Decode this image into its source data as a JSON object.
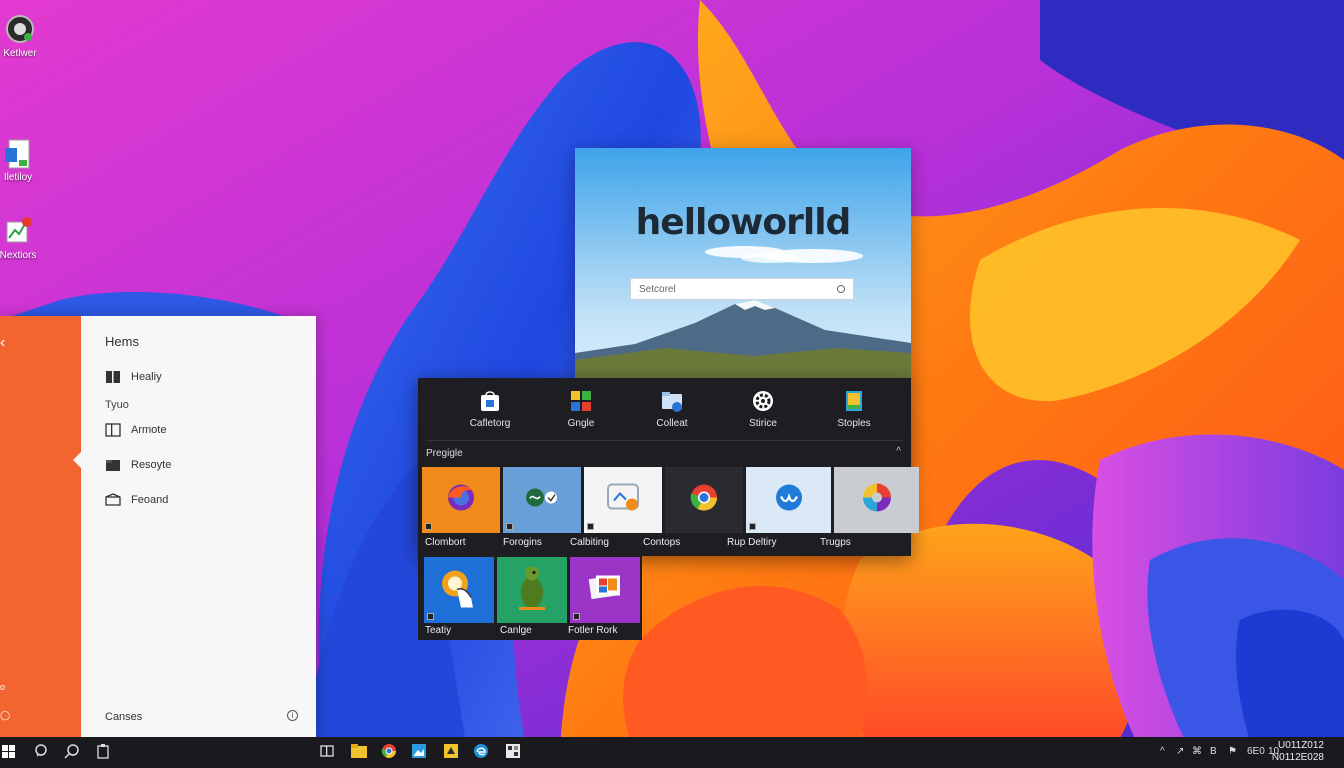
{
  "desktop": {
    "icons": [
      {
        "label": "Ketlwer",
        "icon": "app-circle-icon"
      },
      {
        "label": "Iletiloy",
        "icon": "document-icon"
      },
      {
        "label": "Nextiors",
        "icon": "chart-app-icon"
      }
    ]
  },
  "left_panel": {
    "heading": "Hems",
    "items_top": [
      {
        "label": "Healiy",
        "icon": "book-icon"
      }
    ],
    "subheading": "Tyuo",
    "items": [
      {
        "label": "Armote",
        "icon": "panel-icon"
      },
      {
        "label": "Resoyte",
        "icon": "folder-icon"
      },
      {
        "label": "Feoand",
        "icon": "box-icon"
      }
    ],
    "footer": "Canses",
    "accent_color": "#f26430"
  },
  "browser": {
    "brand": "helloworlld",
    "search_placeholder": "Setcorel"
  },
  "start_menu": {
    "pinned": [
      {
        "label": "Cafletorg",
        "icon": "store-icon"
      },
      {
        "label": "Gngle",
        "icon": "apps-grid-icon"
      },
      {
        "label": "Colleat",
        "icon": "folder-sync-icon"
      },
      {
        "label": "Stirice",
        "icon": "settings-wheel-icon"
      },
      {
        "label": "Stoples",
        "icon": "tablet-icon"
      }
    ],
    "section_title": "Pregigle",
    "collapse_glyph": "^",
    "tiles": [
      {
        "label": "Clombort",
        "icon": "firefox-icon",
        "bg": "#f08a1a"
      },
      {
        "label": "Forogins",
        "icon": "link-icon",
        "bg": "#6aa0d8"
      },
      {
        "label": "Calbiting",
        "icon": "image-viewer-icon",
        "bg": "#f4f4f4"
      },
      {
        "label": "Contops",
        "icon": "chrome-icon",
        "bg": "#2a2b30"
      },
      {
        "label": "Rup Deltiry",
        "icon": "cloud-wave-icon",
        "bg": "#dbe9f6"
      },
      {
        "label": "Trugps",
        "icon": "color-wheel-icon",
        "bg": "#c9ccd1"
      }
    ],
    "tiles_row2": [
      {
        "label": "Teatiy",
        "icon": "hand-gear-icon",
        "bg": "#1f6fd8"
      },
      {
        "label": "Canlge",
        "icon": "bird-icon",
        "bg": "#25a366"
      },
      {
        "label": "Fotler Rork",
        "icon": "photos-icon",
        "bg": "#9b35c8"
      }
    ]
  },
  "taskbar": {
    "tray_glyphs": [
      "^",
      "↗",
      "⌘",
      "B",
      "⚑",
      "6E0",
      "10"
    ],
    "clock_line1": "U011Z012",
    "clock_line2": "N0112E028"
  }
}
